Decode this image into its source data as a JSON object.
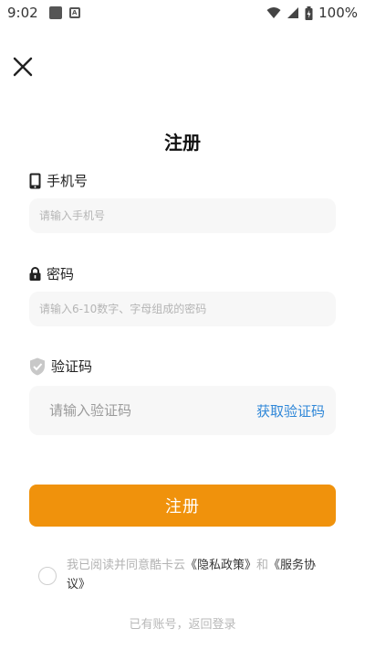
{
  "status_bar": {
    "time": "9:02",
    "battery": "100%"
  },
  "page": {
    "title": "注册"
  },
  "phone": {
    "label": "手机号",
    "placeholder": "请输入手机号",
    "icon": "phone-icon"
  },
  "password": {
    "label": "密码",
    "placeholder": "请输入6-10数字、字母组成的密码",
    "icon": "lock-icon"
  },
  "code": {
    "label": "验证码",
    "placeholder": "请输入验证码",
    "get_code": "获取验证码",
    "icon": "shield-icon"
  },
  "register_button": "注册",
  "agreement": {
    "prefix": "我已阅读并同意酷卡云",
    "privacy": "《隐私政策》",
    "and": "和",
    "service": "《服务协议》"
  },
  "login_link": "已有账号，返回登录",
  "colors": {
    "accent": "#f0920c",
    "link": "#2f87d8"
  }
}
